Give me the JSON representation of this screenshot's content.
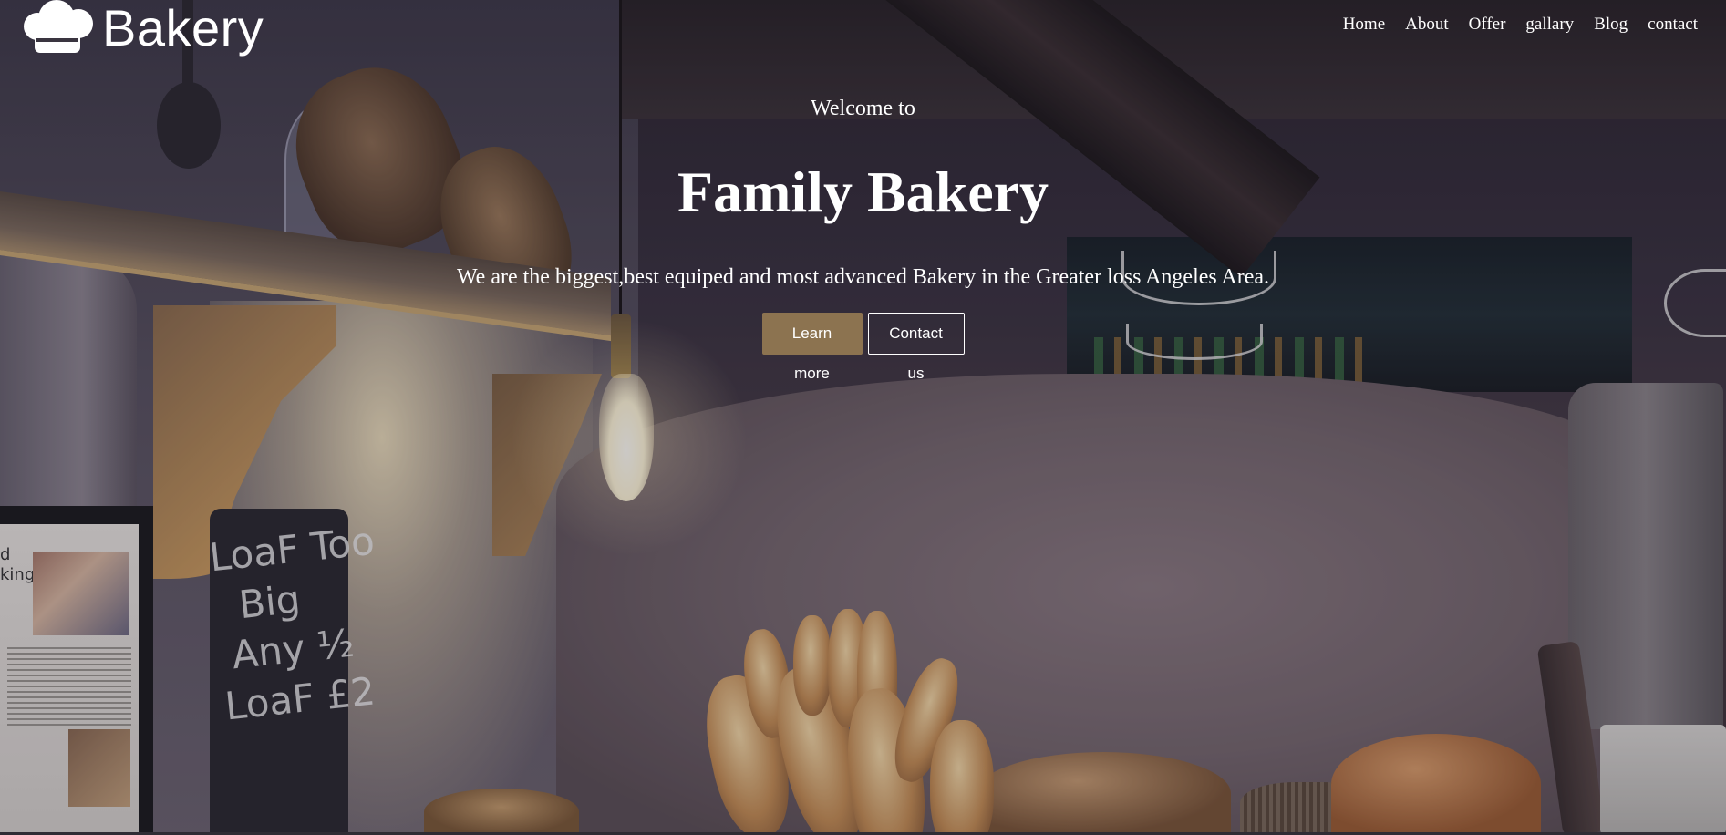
{
  "brand": {
    "name": "Bakery",
    "logo_icon": "chef-hat-icon"
  },
  "nav": {
    "items": [
      {
        "label": "Home"
      },
      {
        "label": "About"
      },
      {
        "label": "Offer"
      },
      {
        "label": "gallary"
      },
      {
        "label": "Blog"
      },
      {
        "label": "contact"
      }
    ]
  },
  "hero": {
    "welcome": "Welcome to",
    "title": "Family Bakery",
    "subtitle": "We are the biggest,best equiped and most advanced Bakery in the Greater loss Angeles Area.",
    "primary_button": "Learn more",
    "secondary_button": "Contact us"
  },
  "background": {
    "chalkboard_text": "LoaF Too\n  Big\n Any ½\nLoaF £2",
    "frame_text": "d\nking"
  },
  "colors": {
    "accent": "#8c7350",
    "text": "#ffffff"
  }
}
